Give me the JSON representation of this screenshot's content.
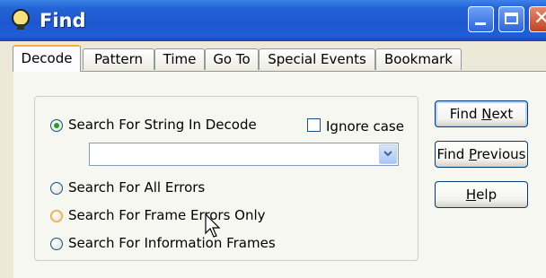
{
  "window": {
    "title": "Find"
  },
  "tabs": [
    "Decode",
    "Pattern",
    "Time",
    "Go To",
    "Special Events",
    "Bookmark"
  ],
  "active_tab": "Decode",
  "options": {
    "search_string": "Search For String In Decode",
    "ignore_case": "Ignore case",
    "all_errors": "Search For All Errors",
    "frame_errors": "Search For Frame Errors Only",
    "info_frames": "Search For Information Frames"
  },
  "search_value": "",
  "buttons": {
    "find_next_pre": "Find ",
    "find_next_u": "N",
    "find_next_post": "ext",
    "find_prev_pre": "Find ",
    "find_prev_u": "P",
    "find_prev_post": "revious",
    "help_u": "H",
    "help_post": "elp"
  },
  "colors": {
    "titlebar": "#1d57d0",
    "accent_tab": "#f5b33d",
    "radio_checked": "#21a121"
  },
  "icons": [
    "app-bulb-icon",
    "minimize-icon",
    "maximize-icon",
    "close-icon",
    "dropdown-arrow-icon",
    "mouse-cursor-icon"
  ]
}
